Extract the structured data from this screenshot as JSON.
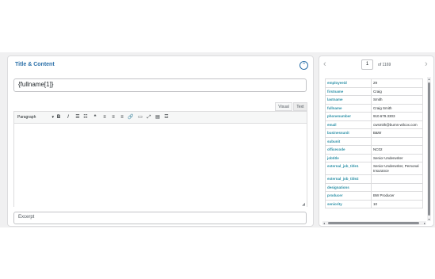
{
  "editor": {
    "section_title": "Title & Content",
    "collapse_icon": "chevron-up-icon",
    "title_value": "{fullname[1]}",
    "tabs": [
      "Visual",
      "Text"
    ],
    "format_select": "Paragraph",
    "toolbar_icons": [
      "bold-icon",
      "italic-icon",
      "bulleted-list-icon",
      "numbered-list-icon",
      "blockquote-icon",
      "align-left-icon",
      "align-center-icon",
      "align-right-icon",
      "link-icon",
      "read-more-icon",
      "fullscreen-icon",
      "toolbar-toggle-icon",
      "kitchen-sink-icon"
    ],
    "toolbar_glyphs": [
      "B",
      "I",
      "☰",
      "☷",
      "❝",
      "≡",
      "≡",
      "≡",
      "🔗",
      "▭",
      "⤢",
      "▤",
      "☲"
    ],
    "excerpt_placeholder": "Excerpt"
  },
  "record": {
    "page": "1",
    "of_label": "of 1169",
    "rows": [
      {
        "key": "employeeid",
        "value": "29"
      },
      {
        "key": "firstname",
        "value": "Craig"
      },
      {
        "key": "lastname",
        "value": "Smith"
      },
      {
        "key": "fullname",
        "value": "Craig Smith"
      },
      {
        "key": "phonenumber",
        "value": "910.679.3303"
      },
      {
        "key": "email",
        "value": "cwsmith@burns-wilcox.com"
      },
      {
        "key": "businessunit",
        "value": "B&W"
      },
      {
        "key": "subunit",
        "value": ""
      },
      {
        "key": "officecode",
        "value": "NC02"
      },
      {
        "key": "jobtitle",
        "value": "Senior Underwriter"
      },
      {
        "key": "external_job_title1",
        "value": "Senior Underwriter, Personal Insurance"
      },
      {
        "key": "external_job_title2",
        "value": ""
      },
      {
        "key": "designations",
        "value": ""
      },
      {
        "key": "producer",
        "value": "BW Producer"
      },
      {
        "key": "seniority",
        "value": "10"
      }
    ]
  }
}
